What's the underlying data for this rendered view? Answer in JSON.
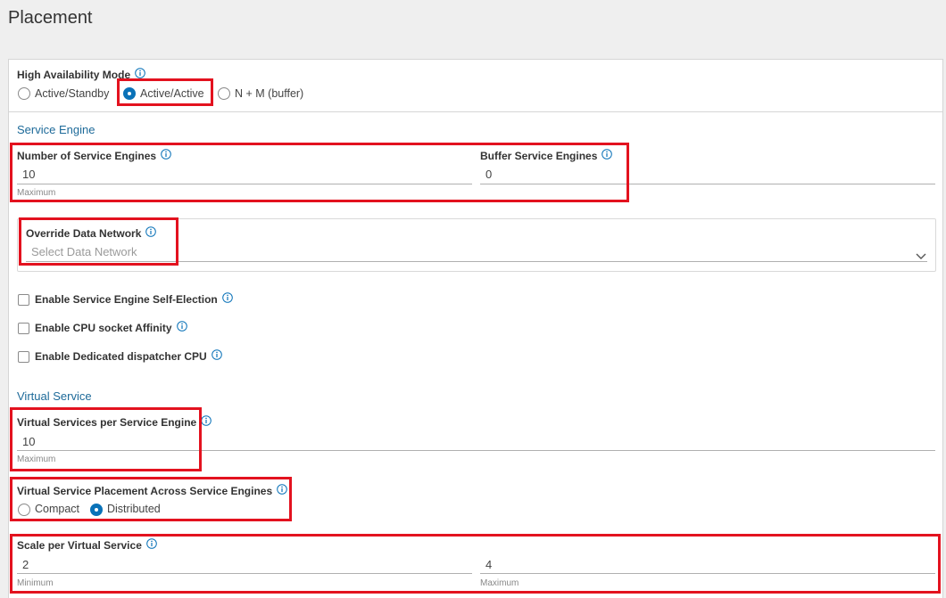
{
  "page": {
    "title": "Placement"
  },
  "ha": {
    "label": "High Availability Mode",
    "options": [
      {
        "label": "Active/Standby",
        "selected": false
      },
      {
        "label": "Active/Active",
        "selected": true
      },
      {
        "label": "N + M (buffer)",
        "selected": false
      }
    ]
  },
  "service_engine": {
    "section_title": "Service Engine",
    "num_se": {
      "label": "Number of Service Engines",
      "value": "10",
      "helper": "Maximum"
    },
    "buffer_se": {
      "label": "Buffer Service Engines",
      "value": "0"
    },
    "override_network": {
      "label": "Override Data Network",
      "placeholder": "Select Data Network"
    },
    "checkboxes": [
      {
        "label": "Enable Service Engine Self-Election",
        "checked": false
      },
      {
        "label": "Enable CPU socket Affinity",
        "checked": false
      },
      {
        "label": "Enable Dedicated dispatcher CPU",
        "checked": false
      }
    ]
  },
  "virtual_service": {
    "section_title": "Virtual Service",
    "vs_per_se": {
      "label": "Virtual Services per Service Engine",
      "value": "10",
      "helper": "Maximum"
    },
    "placement": {
      "label": "Virtual Service Placement Across Service Engines",
      "options": [
        {
          "label": "Compact",
          "selected": false
        },
        {
          "label": "Distributed",
          "selected": true
        }
      ]
    },
    "scale": {
      "label": "Scale per Virtual Service",
      "min_value": "2",
      "min_helper": "Minimum",
      "max_value": "4",
      "max_helper": "Maximum"
    }
  },
  "colors": {
    "accent": "#0a72b8",
    "section": "#1d6a99",
    "highlight": "#e3121f"
  },
  "icons": {
    "info": "info-icon",
    "chevron": "chevron-down-icon"
  }
}
